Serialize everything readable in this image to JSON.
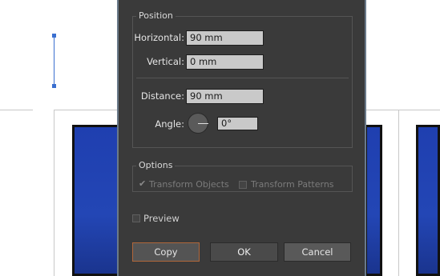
{
  "dialog": {
    "position_group": {
      "title": "Position",
      "horizontal_label": "Horizontal:",
      "horizontal_value": "90 mm",
      "vertical_label": "Vertical:",
      "vertical_value": "0 mm",
      "distance_label": "Distance:",
      "distance_value": "90 mm",
      "angle_label": "Angle:",
      "angle_value": "0°"
    },
    "options_group": {
      "title": "Options",
      "transform_objects_label": "Transform Objects",
      "transform_objects_checked": true,
      "transform_patterns_label": "Transform Patterns",
      "transform_patterns_checked": false
    },
    "preview": {
      "label": "Preview",
      "checked": false
    },
    "buttons": {
      "copy": "Copy",
      "ok": "OK",
      "cancel": "Cancel"
    }
  },
  "icons": {
    "angle_dial": "angle-dial-icon",
    "checkmark": "checkmark-icon"
  },
  "colors": {
    "dialog_bg": "#3a3a3a",
    "copy_focus_border": "#b0663a",
    "artwork_blue": "#2346b5"
  }
}
